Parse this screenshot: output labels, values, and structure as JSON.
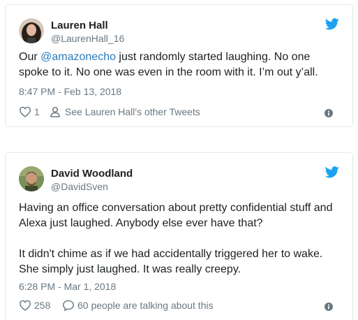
{
  "tweets": [
    {
      "name": "Lauren Hall",
      "handle": "@LaurenHall_16",
      "text_mention": "@amazonecho",
      "text_before": "Our ",
      "text_after": " just randomly started laughing. No one spoke to it. No one was even in the room with it. I’m out y’all.",
      "timestamp": "8:47 PM - Feb 13, 2018",
      "likes": "1",
      "secondary_action": "See Lauren Hall's other Tweets",
      "icons": {
        "like": "heart-icon",
        "secondary": "person-icon",
        "brand": "twitter-bird-icon",
        "info": "info-icon"
      }
    },
    {
      "name": "David Woodland",
      "handle": "@DavidSven",
      "paragraphs": [
        "Having an office conversation about pretty confidential stuff and Alexa just laughed. Anybody else ever have that?",
        "It didn't chime as if we had accidentally triggered her to wake. She simply just laughed. It was really creepy."
      ],
      "timestamp": "6:28 PM - Mar 1, 2018",
      "likes": "258",
      "secondary_action": "60 people are talking about this",
      "icons": {
        "like": "heart-icon",
        "secondary": "comment-bubble-icon",
        "brand": "twitter-bird-icon",
        "info": "info-icon"
      }
    }
  ],
  "colors": {
    "text": "#1c2022",
    "muted": "#697882",
    "link": "#2b7bb9",
    "brand": "#1da1f2",
    "border": "#e1e8ed"
  }
}
